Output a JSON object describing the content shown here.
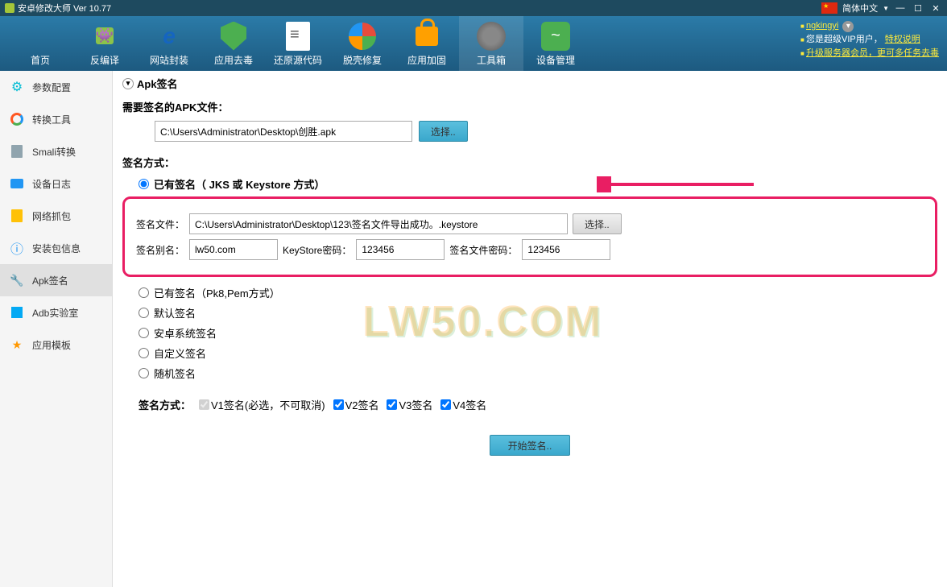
{
  "titlebar": {
    "title": "安卓修改大师 Ver 10.77",
    "lang": "简体中文"
  },
  "toolbar": {
    "items": [
      {
        "label": "首页"
      },
      {
        "label": "反编译"
      },
      {
        "label": "网站封装"
      },
      {
        "label": "应用去毒"
      },
      {
        "label": "还原源代码"
      },
      {
        "label": "脱壳修复"
      },
      {
        "label": "应用加固"
      },
      {
        "label": "工具箱"
      },
      {
        "label": "设备管理"
      }
    ]
  },
  "user": {
    "name": "ngkingyi",
    "vip_text": "您是超级VIP用户，",
    "priv_label": "特权说明",
    "upgrade_text": "升级服务器会员，更可多任务去毒"
  },
  "sidebar": {
    "items": [
      {
        "label": "参数配置"
      },
      {
        "label": "转换工具"
      },
      {
        "label": "Smali转换"
      },
      {
        "label": "设备日志"
      },
      {
        "label": "网络抓包"
      },
      {
        "label": "安装包信息"
      },
      {
        "label": "Apk签名"
      },
      {
        "label": "Adb实验室"
      },
      {
        "label": "应用模板"
      }
    ]
  },
  "content": {
    "section_title": "Apk签名",
    "apk_label": "需要签名的APK文件：",
    "apk_path": "C:\\Users\\Administrator\\Desktop\\创胜.apk",
    "select_btn": "选择..",
    "sign_mode_label": "签名方式：",
    "radios": {
      "jks": "已有签名（ JKS 或 Keystore 方式）",
      "pk8": "已有签名（Pk8,Pem方式）",
      "default": "默认签名",
      "android": "安卓系统签名",
      "custom": "自定义签名",
      "random": "随机签名"
    },
    "sign_file_label": "签名文件：",
    "sign_file_path": "C:\\Users\\Administrator\\Desktop\\123\\签名文件导出成功。.keystore",
    "alias_label": "签名别名：",
    "alias_value": "lw50.com",
    "keystore_pwd_label": "KeyStore密码：",
    "keystore_pwd_value": "123456",
    "sign_pwd_label": "签名文件密码：",
    "sign_pwd_value": "123456",
    "scheme_label": "签名方式：",
    "v1": "V1签名(必选，不可取消)",
    "v2": "V2签名",
    "v3": "V3签名",
    "v4": "V4签名",
    "start_btn": "开始签名..",
    "watermark": "LW50.COM"
  }
}
